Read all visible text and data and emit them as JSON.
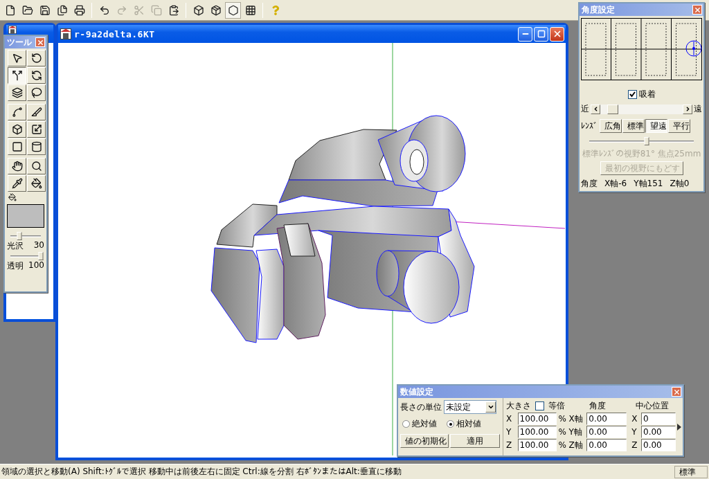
{
  "toolbar": {
    "groups": [
      [
        {
          "kind": "new",
          "disabled": false,
          "selected": false
        },
        {
          "kind": "open",
          "disabled": false,
          "selected": false
        },
        {
          "kind": "save",
          "disabled": false,
          "selected": false
        },
        {
          "kind": "saveall",
          "disabled": false,
          "selected": false
        },
        {
          "kind": "print",
          "disabled": false,
          "selected": false
        }
      ],
      [
        {
          "kind": "undo",
          "disabled": false,
          "selected": false
        },
        {
          "kind": "redo",
          "disabled": true,
          "selected": false
        },
        {
          "kind": "cut",
          "disabled": true,
          "selected": false
        },
        {
          "kind": "copy",
          "disabled": true,
          "selected": false
        },
        {
          "kind": "paste",
          "disabled": false,
          "selected": false
        }
      ],
      [
        {
          "kind": "front",
          "disabled": false,
          "selected": false
        },
        {
          "kind": "side",
          "disabled": false,
          "selected": false
        },
        {
          "kind": "top",
          "disabled": false,
          "selected": true
        },
        {
          "kind": "wire",
          "disabled": false,
          "selected": false
        }
      ],
      [
        {
          "kind": "help",
          "disabled": false,
          "selected": false
        }
      ]
    ]
  },
  "document_window": {
    "title": "r-9a2delta.6KT"
  },
  "tool_palette": {
    "title": "ツール",
    "groups": [
      [
        {
          "kind": "select",
          "selected": false
        },
        {
          "kind": "rotate",
          "selected": false
        },
        {
          "kind": "bend",
          "selected": true
        },
        {
          "kind": "spin",
          "selected": false
        },
        {
          "kind": "step",
          "selected": false
        },
        {
          "kind": "lasso",
          "selected": false
        }
      ],
      [
        {
          "kind": "curve",
          "selected": false
        },
        {
          "kind": "knife",
          "selected": false
        },
        {
          "kind": "extrude",
          "selected": false
        },
        {
          "kind": "scale",
          "selected": false
        },
        {
          "kind": "plane",
          "selected": false
        },
        {
          "kind": "cylinder",
          "selected": false
        }
      ],
      [
        {
          "kind": "hand",
          "selected": false
        },
        {
          "kind": "zoom",
          "selected": false
        },
        {
          "kind": "dropper",
          "selected": false
        },
        {
          "kind": "fill",
          "selected": false
        }
      ]
    ],
    "sliders": [
      {
        "label": "光沢",
        "value": "30",
        "level": 0.3
      },
      {
        "label": "透明",
        "value": "100",
        "level": 1.0
      }
    ]
  },
  "angle_panel": {
    "title": "角度設定",
    "snap": {
      "label": "吸着",
      "checked": true
    },
    "distance": {
      "near": "近",
      "far": "遠"
    },
    "lens": {
      "label": "ﾚﾝｽﾞ",
      "buttons": [
        {
          "label": "広角",
          "selected": false
        },
        {
          "label": "標準",
          "selected": false
        },
        {
          "label": "望遠",
          "selected": true
        },
        {
          "label": "平行",
          "selected": false
        }
      ],
      "level": 0.55
    },
    "info": "標準ﾚﾝｽﾞの視野81° 焦点25mm",
    "reset": {
      "label": "最初の視野にもどす",
      "disabled": true
    },
    "angles": {
      "label": "角度",
      "values": [
        "X軸-6",
        "Y軸151",
        "Z軸0"
      ]
    }
  },
  "numeric_panel": {
    "title": "数値設定",
    "unit": {
      "label": "長さの単位",
      "value": "未設定"
    },
    "modes": [
      {
        "label": "絶対値",
        "selected": false
      },
      {
        "label": "相対値",
        "selected": true
      }
    ],
    "buttons": [
      "値の初期化",
      "適用"
    ],
    "size": {
      "label": "大きさ",
      "uniform": {
        "label": "等倍",
        "checked": false
      }
    },
    "angle_heading": "角度",
    "center_heading": "中心位置",
    "rows": [
      {
        "axis": "X",
        "size": "100.00",
        "unit": "%",
        "angle_axis": "X軸",
        "angle": "0.00",
        "center_axis": "X",
        "center": "0"
      },
      {
        "axis": "Y",
        "size": "100.00",
        "unit": "%",
        "angle_axis": "Y軸",
        "angle": "0.00",
        "center_axis": "Y",
        "center": "0.00"
      },
      {
        "axis": "Z",
        "size": "100.00",
        "unit": "%",
        "angle_axis": "Z軸",
        "angle": "0.00",
        "center_axis": "Z",
        "center": "0.00"
      }
    ]
  },
  "status_bar": {
    "message": "領域の選択と移動(A)  Shift:ﾄｸﾞﾙで選択 移動中は前後左右に固定  Ctrl:線を分割  右ﾎﾞﾀﾝまたはAlt:垂直に移動",
    "mode": "標準"
  }
}
